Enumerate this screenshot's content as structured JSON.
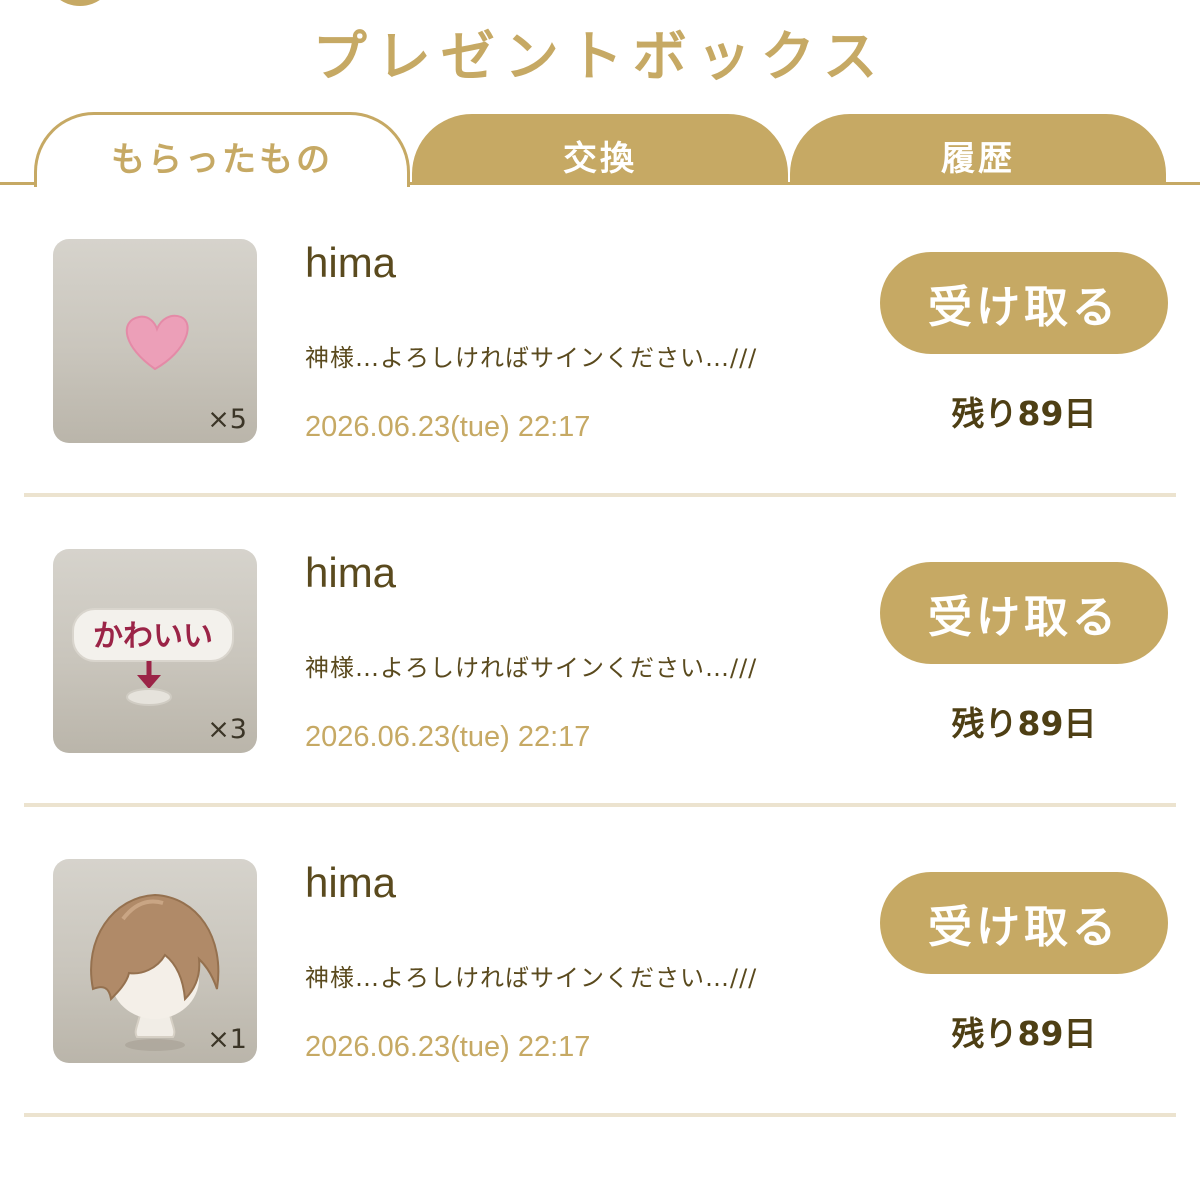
{
  "header": {
    "title": "プレゼントボックス"
  },
  "tabs": [
    {
      "label": "もらったもの",
      "active": true
    },
    {
      "label": "交換",
      "active": false
    },
    {
      "label": "履歴",
      "active": false
    }
  ],
  "colors": {
    "gold": "#c6a964",
    "text_brown": "#5a4a1e",
    "divider": "#ece3cf"
  },
  "items": [
    {
      "icon": "pink-heart-icon",
      "quantity": "×5",
      "sender": "hima",
      "message": "神様…よろしければサインください…///",
      "date": "2026.06.23(tue) 22:17",
      "button_label": "受け取る",
      "remaining": "残り89日"
    },
    {
      "icon": "kawaii-sign-icon",
      "sign_text": "かわいい",
      "quantity": "×3",
      "sender": "hima",
      "message": "神様…よろしければサインください…///",
      "date": "2026.06.23(tue) 22:17",
      "button_label": "受け取る",
      "remaining": "残り89日"
    },
    {
      "icon": "hair-wig-icon",
      "quantity": "×1",
      "sender": "hima",
      "message": "神様…よろしければサインください…///",
      "date": "2026.06.23(tue) 22:17",
      "button_label": "受け取る",
      "remaining": "残り89日"
    }
  ]
}
